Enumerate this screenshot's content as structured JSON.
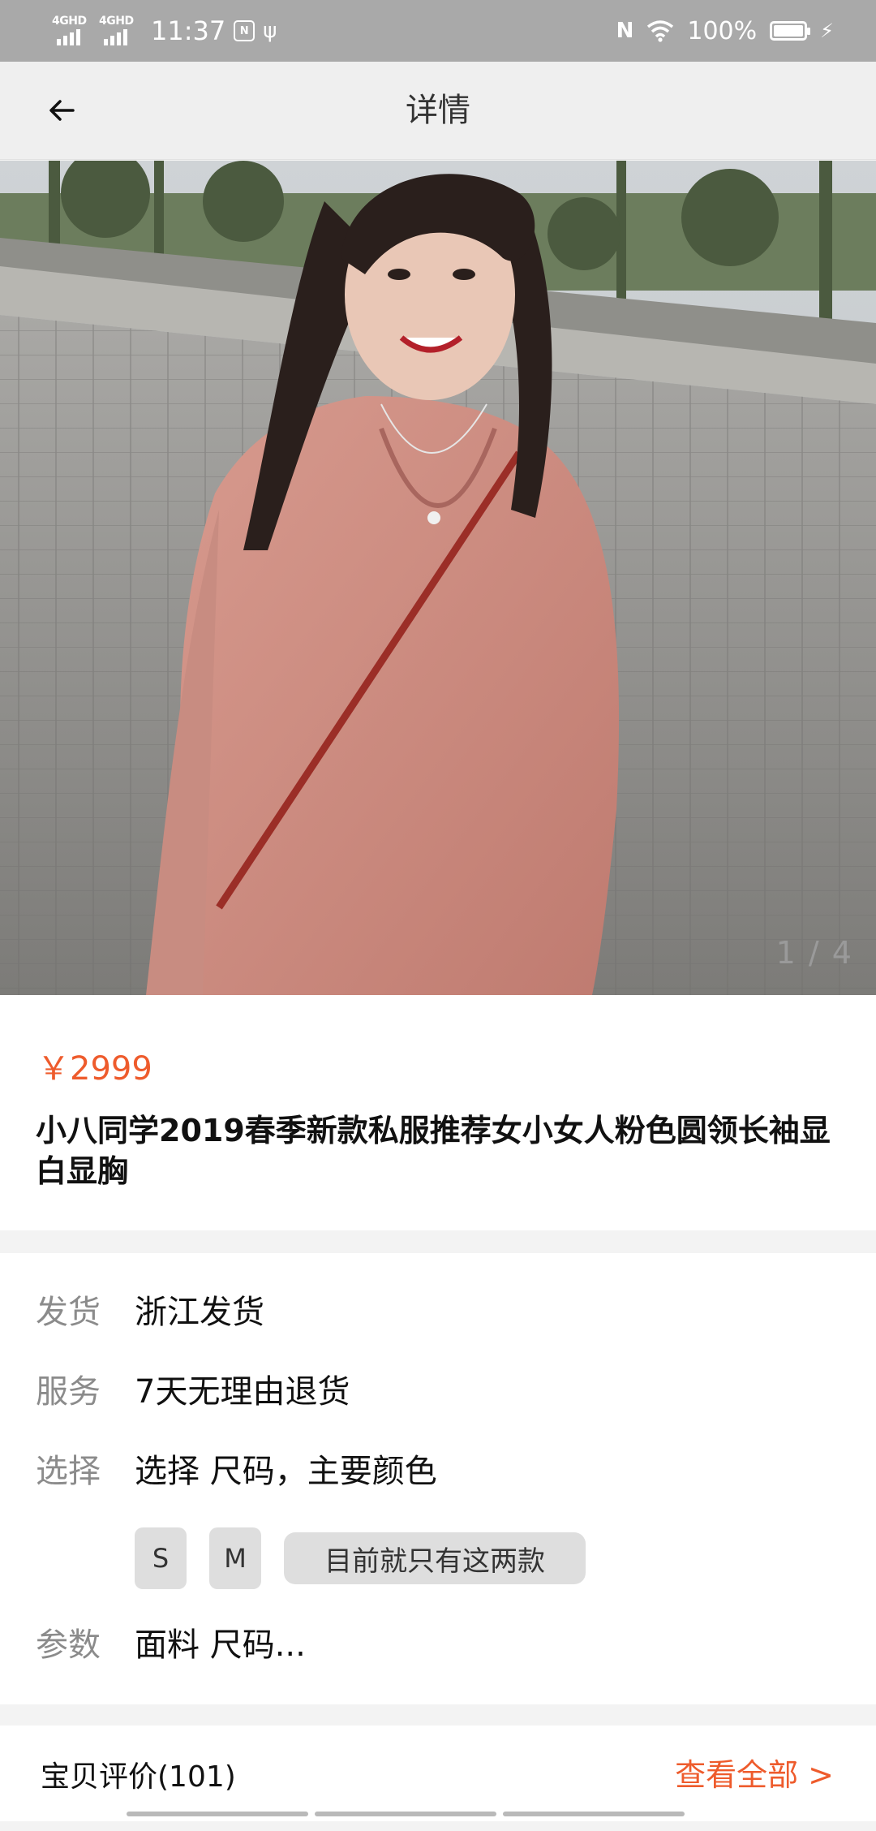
{
  "status_bar": {
    "network_1": "4GHD",
    "network_2": "4GHD",
    "time": "11:37",
    "battery": "100%"
  },
  "header": {
    "title": "详情"
  },
  "gallery": {
    "counter": "1 / 4"
  },
  "product": {
    "price": "￥2999",
    "title": "小八同学2019春季新款私服推荐女小女人粉色圆领长袖显白显胸"
  },
  "info": {
    "shipping": {
      "label": "发货",
      "value": "浙江发货"
    },
    "service": {
      "label": "服务",
      "value": "7天无理由退货"
    },
    "select": {
      "label": "选择",
      "value": "选择 尺码，主要颜色"
    },
    "sizes": [
      "S",
      "M"
    ],
    "size_note": "目前就只有这两款",
    "params": {
      "label": "参数",
      "value": "面料 尺码..."
    }
  },
  "reviews": {
    "title": "宝贝评价(101)",
    "view_all": "查看全部 >"
  },
  "colors": {
    "accent": "#ee5b2c",
    "topbar_bg": "#efefef",
    "status_bar_bg": "#a9a9a9",
    "chip_bg": "#dedede"
  }
}
